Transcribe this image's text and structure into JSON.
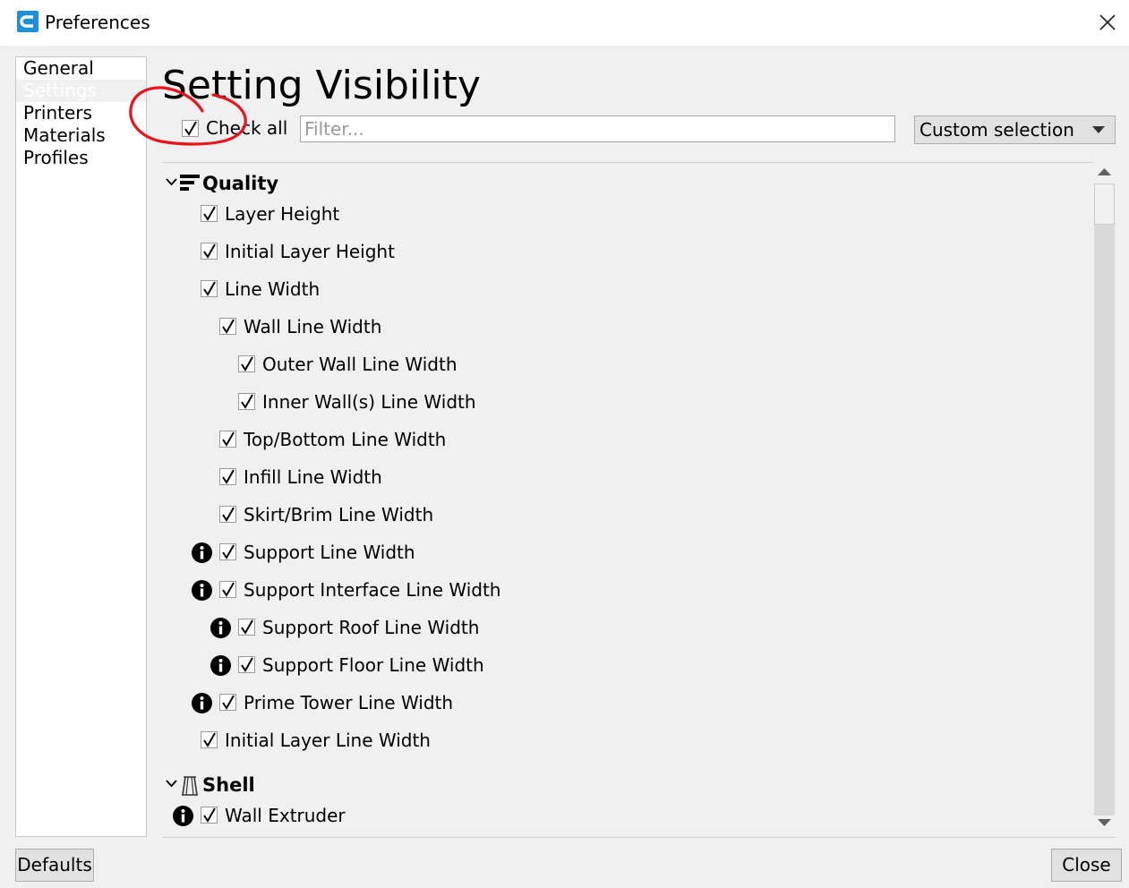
{
  "window": {
    "title": "Preferences"
  },
  "sidebar": {
    "items": [
      {
        "label": "General",
        "selected": false
      },
      {
        "label": "Settings",
        "selected": true
      },
      {
        "label": "Printers",
        "selected": false
      },
      {
        "label": "Materials",
        "selected": false
      },
      {
        "label": "Profiles",
        "selected": false
      }
    ]
  },
  "main": {
    "title": "Setting Visibility",
    "check_all_label": "Check all",
    "check_all_checked": true,
    "filter_placeholder": "Filter...",
    "filter_value": "",
    "selection_dropdown": "Custom selection"
  },
  "settings_list": {
    "categories": [
      {
        "label": "Quality",
        "icon": "quality-icon",
        "expanded": true
      },
      {
        "label": "Shell",
        "icon": "shell-icon",
        "expanded": true
      }
    ],
    "quality_items": [
      {
        "label": "Layer Height",
        "level": 0,
        "info": false,
        "checked": true
      },
      {
        "label": "Initial Layer Height",
        "level": 0,
        "info": false,
        "checked": true
      },
      {
        "label": "Line Width",
        "level": 0,
        "info": false,
        "checked": true
      },
      {
        "label": "Wall Line Width",
        "level": 1,
        "info": false,
        "checked": true
      },
      {
        "label": "Outer Wall Line Width",
        "level": 2,
        "info": false,
        "checked": true
      },
      {
        "label": "Inner Wall(s) Line Width",
        "level": 2,
        "info": false,
        "checked": true
      },
      {
        "label": "Top/Bottom Line Width",
        "level": 1,
        "info": false,
        "checked": true
      },
      {
        "label": "Infill Line Width",
        "level": 1,
        "info": false,
        "checked": true
      },
      {
        "label": "Skirt/Brim Line Width",
        "level": 1,
        "info": false,
        "checked": true
      },
      {
        "label": "Support Line Width",
        "level": 1,
        "info": true,
        "checked": true
      },
      {
        "label": "Support Interface Line Width",
        "level": 1,
        "info": true,
        "checked": true
      },
      {
        "label": "Support Roof Line Width",
        "level": 2,
        "info": true,
        "checked": true
      },
      {
        "label": "Support Floor Line Width",
        "level": 2,
        "info": true,
        "checked": true
      },
      {
        "label": "Prime Tower Line Width",
        "level": 1,
        "info": true,
        "checked": true
      },
      {
        "label": "Initial Layer Line Width",
        "level": 0,
        "info": false,
        "checked": true
      }
    ],
    "shell_items": [
      {
        "label": "Wall Extruder",
        "level": 0,
        "info": true,
        "checked": true
      }
    ]
  },
  "footer": {
    "defaults_label": "Defaults",
    "close_label": "Close"
  },
  "colors": {
    "app_icon": "#1e90d8",
    "annotation": "#e8131b",
    "sidebar_selected_text": "#ffffff"
  }
}
